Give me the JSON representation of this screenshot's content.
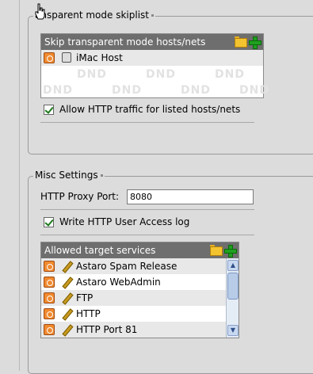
{
  "transparent_skiplist": {
    "legend": "ansparent mode skiplist",
    "list": {
      "header": "Skip transparent mode hosts/nets",
      "items": [
        {
          "label": "iMac Host",
          "icon": "mac-host-icon"
        }
      ],
      "watermark": "DND"
    },
    "allow_http_label": "Allow HTTP traffic for listed hosts/nets",
    "allow_http_checked": true
  },
  "misc_settings": {
    "legend": "Misc Settings",
    "proxy_port_label": "HTTP Proxy Port:",
    "proxy_port_value": "8080",
    "write_log_label": "Write HTTP User Access log",
    "write_log_checked": true,
    "services": {
      "header": "Allowed target services",
      "items": [
        {
          "label": "Astaro Spam Release"
        },
        {
          "label": "Astaro WebAdmin"
        },
        {
          "label": "FTP"
        },
        {
          "label": "HTTP"
        },
        {
          "label": "HTTP Port 81"
        }
      ]
    }
  },
  "colors": {
    "background": "#dcdcdc",
    "header": "#6e6e6e",
    "trash": "#f08a30",
    "plus": "#1fa01f",
    "folder": "#f4c430"
  }
}
